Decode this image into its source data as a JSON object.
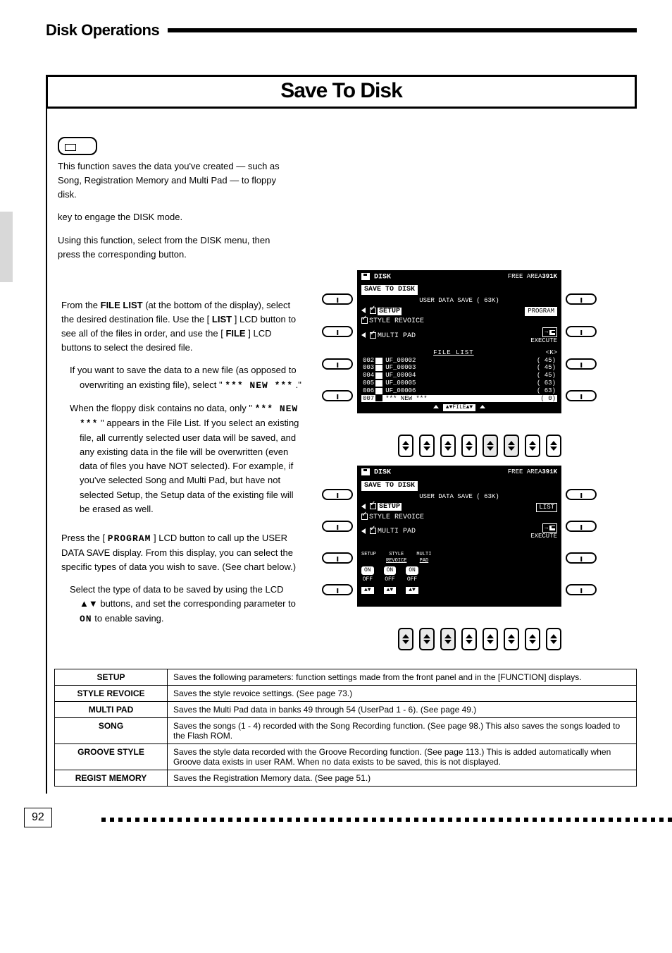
{
  "header": {
    "section_title": "Disk Operations",
    "main_title": "Save To Disk"
  },
  "intro": {
    "p1": "This function saves the data you've created — such as Song, Registration Memory and Multi Pad — to floppy disk.",
    "btn_hint": "key to engage the DISK mode.",
    "p2_pre": "Using this function, select ",
    "p2_post": " from the DISK menu, then press the corresponding button."
  },
  "steps": {
    "s1": {
      "text_a": "From the ",
      "file_list": "FILE LIST",
      "text_b": " (at the bottom of the display), select the desired destination file. Use the [",
      "list": "LIST",
      "text_c": "] LCD button to see all of the files in order, and use the [",
      "file": "FILE",
      "text_d": "] LCD buttons to select the desired file.",
      "text_e": "If you want to save the data to a new file (as opposed to overwriting an existing file), select \"",
      "new_label": "*** NEW ***",
      "text_f": ".\"",
      "text_g": "When the floppy disk contains no data, only \"",
      "new2_label": "*** NEW",
      "new2_label2": "***",
      "text_h": "\" appears in the File List. If you select an existing file, all currently selected user data will be saved, and any existing data in the file will be overwritten (even data of files you have NOT selected). For example, if you've selected Song and Multi Pad, but have not selected Setup, the Setup data of the existing file will be erased as well."
    },
    "s2": {
      "text_a": "Press the [",
      "program": "PROGRAM",
      "text_b": "] LCD button to call up the USER DATA SAVE display. From this display, you can select the specific types of data you wish to save. (See chart below.)",
      "text_c": "Select the type of data to be saved by using the LCD ▲▼ buttons, and set the corresponding parameter to ",
      "on": "ON",
      "text_d": " to enable saving."
    }
  },
  "screens": {
    "free_area": "391K",
    "disk_label": "DISK",
    "save_tab": "SAVE TO DISK",
    "user_data_save": "USER DATA SAVE (  63K)",
    "items": [
      "SETUP",
      "STYLE REVOICE",
      "MULTI PAD"
    ],
    "program_btn": "PROGRAM",
    "list_btn": "LIST",
    "execute": "EXECUTE",
    "file_list_header": "FILE LIST",
    "kk": "<K>",
    "files": [
      {
        "idx": "002",
        "name": "UF_00002",
        "size": "45"
      },
      {
        "idx": "003",
        "name": "UF_00003",
        "size": "45"
      },
      {
        "idx": "004",
        "name": "UF_00004",
        "size": "45"
      },
      {
        "idx": "005",
        "name": "UF_00005",
        "size": "63"
      },
      {
        "idx": "006",
        "name": "UF_00006",
        "size": "63"
      }
    ],
    "new_row": {
      "idx": "007",
      "name": "*** NEW ***",
      "size": "0"
    },
    "avfile": "▲▼FILE▲▼",
    "free_area_label": "FREE AREA",
    "prog_opts": {
      "headers": [
        "SETUP",
        "STYLE REVOICE",
        "MULTI PAD"
      ],
      "onoff": [
        [
          "ON",
          "OFF"
        ],
        [
          "ON",
          "OFF"
        ],
        [
          "ON",
          "OFF"
        ]
      ],
      "av": "▲▼"
    }
  },
  "table": {
    "rows": [
      {
        "k": "SETUP",
        "v": "Saves the following parameters: function settings made from the front panel and in the [FUNCTION] displays."
      },
      {
        "k": "STYLE REVOICE",
        "v": "Saves the style revoice settings. (See page 73.)"
      },
      {
        "k": "MULTI PAD",
        "v": "Saves the Multi Pad data in banks 49 through 54 (UserPad 1 - 6). (See page 49.)"
      },
      {
        "k": "SONG",
        "v": "Saves the songs (1 - 4) recorded with the Song Recording function. (See page 98.) This also saves the songs loaded to the Flash ROM."
      },
      {
        "k": "GROOVE STYLE",
        "v": "Saves the style data recorded with the Groove Recording function. (See page 113.) This is added automatically when Groove data exists in user RAM. When no data exists to be saved, this is not displayed."
      },
      {
        "k": "REGIST MEMORY",
        "v": "Saves the Registration Memory data. (See page 51.)"
      }
    ]
  },
  "footer": {
    "page_no": "92"
  }
}
